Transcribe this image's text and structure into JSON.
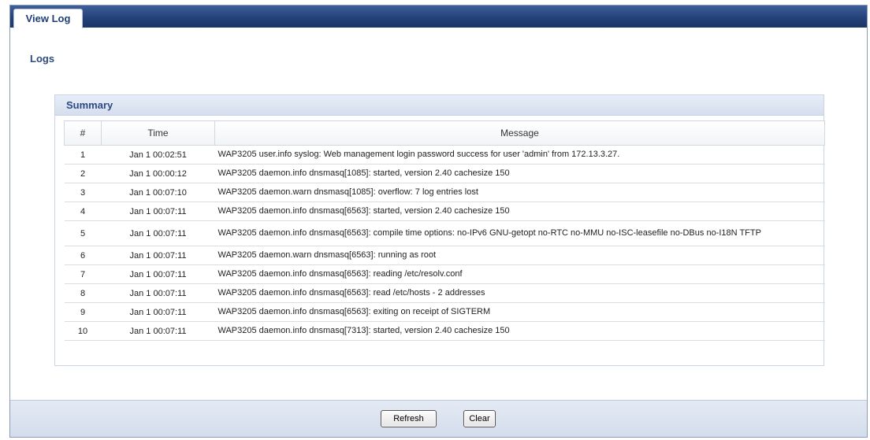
{
  "tabs": [
    {
      "label": "View Log",
      "active": true
    }
  ],
  "section": {
    "title": "Logs"
  },
  "summary": {
    "title": "Summary",
    "columns": [
      "#",
      "Time",
      "Message"
    ],
    "rows": [
      {
        "num": "1",
        "time": "Jan 1 00:02:51",
        "message": "WAP3205 user.info syslog: Web management login password success for user 'admin' from 172.13.3.27."
      },
      {
        "num": "2",
        "time": "Jan 1 00:00:12",
        "message": "WAP3205 daemon.info dnsmasq[1085]: started, version 2.40 cachesize 150"
      },
      {
        "num": "3",
        "time": "Jan 1 00:07:10",
        "message": "WAP3205 daemon.warn dnsmasq[1085]: overflow: 7 log entries lost"
      },
      {
        "num": "4",
        "time": "Jan 1 00:07:11",
        "message": "WAP3205 daemon.info dnsmasq[6563]: started, version 2.40 cachesize 150"
      },
      {
        "num": "5",
        "time": "Jan 1 00:07:11",
        "message": "WAP3205 daemon.info dnsmasq[6563]: compile time options: no-IPv6 GNU-getopt no-RTC no-MMU no-ISC-leasefile no-DBus no-I18N TFTP"
      },
      {
        "num": "6",
        "time": "Jan 1 00:07:11",
        "message": "WAP3205 daemon.warn dnsmasq[6563]: running as root"
      },
      {
        "num": "7",
        "time": "Jan 1 00:07:11",
        "message": "WAP3205 daemon.info dnsmasq[6563]: reading /etc/resolv.conf"
      },
      {
        "num": "8",
        "time": "Jan 1 00:07:11",
        "message": "WAP3205 daemon.info dnsmasq[6563]: read /etc/hosts - 2 addresses"
      },
      {
        "num": "9",
        "time": "Jan 1 00:07:11",
        "message": "WAP3205 daemon.info dnsmasq[6563]: exiting on receipt of SIGTERM"
      },
      {
        "num": "10",
        "time": "Jan 1 00:07:11",
        "message": "WAP3205 daemon.info dnsmasq[7313]: started, version 2.40 cachesize 150"
      }
    ]
  },
  "buttons": {
    "refresh": "Refresh",
    "clear": "Clear"
  },
  "colors": {
    "tabbar": "#24427a",
    "title_text": "#2c4a82",
    "footer": "#d4ddec"
  }
}
